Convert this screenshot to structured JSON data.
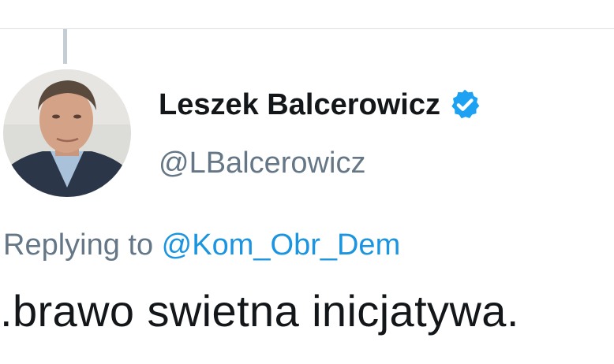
{
  "tweet": {
    "author": {
      "display_name": "Leszek Balcerowicz",
      "handle": "@LBalcerowicz",
      "verified": true,
      "avatar_icon": "profile-photo"
    },
    "reply": {
      "prefix": "Replying to ",
      "target": "@Kom_Obr_Dem"
    },
    "text": ".brawo swietna inicjatywa."
  },
  "colors": {
    "name": "#14171a",
    "secondary": "#657786",
    "link": "#1b95e0",
    "verified": "#1da1f2",
    "divider": "#dcdfe3",
    "thread_line": "#c4cdd4"
  }
}
